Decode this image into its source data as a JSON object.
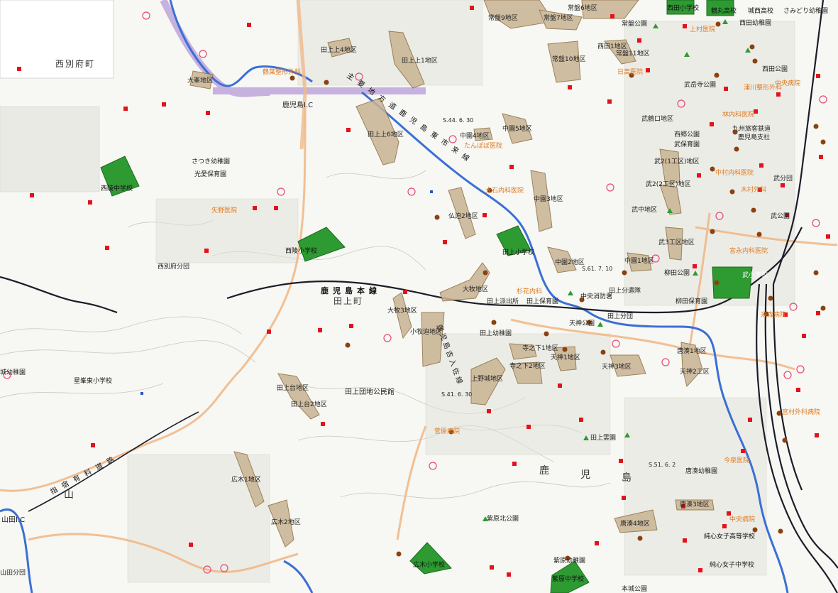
{
  "map": {
    "town_names": [
      "西別府町",
      "田上町",
      "鹿",
      "児",
      "島",
      "山"
    ],
    "rail_label": "鹿児島本線",
    "road_label_1": "主要地方道鹿児島東市来線",
    "road_label_2": "指宿有料道路",
    "road_label_3": "鹿児島吉入佐線",
    "interchanges": [
      "鹿児島I.C",
      "山田I.C"
    ],
    "hazard_zones": [
      "大峯地区",
      "田上上4地区",
      "田上上1地区",
      "田上上6地区",
      "常盤9地区",
      "常盤7地区",
      "常盤6地区",
      "常盤10地区",
      "西田1地区",
      "常盤11地区",
      "中園4地区",
      "中園5地区",
      "中園3地区",
      "中園2地区",
      "中園1地区",
      "仏迫2地区",
      "大牧地区",
      "大牧3地区",
      "小牧迫地区",
      "田上台地区",
      "田上台2地区",
      "上野城地区",
      "寺之下1地区",
      "寺之下2地区",
      "天神1地区",
      "天神3地区",
      "唐湊1地区",
      "天神2工区",
      "広木1地区",
      "広木2地区",
      "唐湊4地区",
      "唐湊3地区",
      "武2(1工区)地区",
      "武2(2工区)地区",
      "武3工区地区",
      "武中地区",
      "武鶴口地区"
    ],
    "schools": [
      "西陵中学校",
      "西陵小学校",
      "田上小学校",
      "武小学校",
      "西田小学校",
      "広木小学校",
      "紫原中学校",
      "星峯東小学校",
      "鶴丸高校",
      "城西高校",
      "純心女子高等学校",
      "純心女子中学校"
    ],
    "kindergartens": [
      "さつき幼稚園",
      "光愛保育園",
      "田上幼稚園",
      "田上保育園",
      "西田幼稚園",
      "さみどり幼稚園",
      "柳田保育園",
      "唐湊幼稚園",
      "紫原幼稚園",
      "城幼稚園"
    ],
    "public": [
      "西別府分団",
      "田上分団",
      "山田分団",
      "田上派出所",
      "中央消防署",
      "田上分遣隊",
      "九州旅客鉄道",
      "鹿児島支社",
      "武保育園",
      "田上団地公民館",
      "西田公園",
      "武岳寺公園",
      "常盤公園",
      "西郷公園",
      "天神公園",
      "田上霊園",
      "紫原北公園",
      "本城公園",
      "武分団",
      "武公園",
      "柳田公園"
    ],
    "hospitals": [
      "鶴葉整形外科",
      "たんぽぽ医院",
      "矢野医院",
      "大石内科医院",
      "宮永内科医院",
      "菅原病院",
      "中央病院",
      "杉花内科",
      "今泉医院",
      "日高医院",
      "宮村外科病院",
      "米森病院",
      "上村医院",
      "木村外科",
      "中村内科医院",
      "浦川整形外科",
      "中央病院",
      "林内科医院"
    ],
    "route_marks": [
      "S.44. 6. 30",
      "S.41. 6. 30",
      "S.61. 7. 10",
      "S.51. 6. 2"
    ]
  },
  "colors": {
    "hazard_fill": "#c9b493",
    "hazard_stroke": "#8c6d3f",
    "school_green": "#2e9a32",
    "river_blue": "#3b6fd6",
    "expressway_purple": "#b69ad9",
    "road_orange": "#f0b98a",
    "rail_black": "#1c1c2a",
    "marker_red": "#e3121b",
    "marker_brown": "#8a4210",
    "text_orange": "#e07a1f"
  }
}
